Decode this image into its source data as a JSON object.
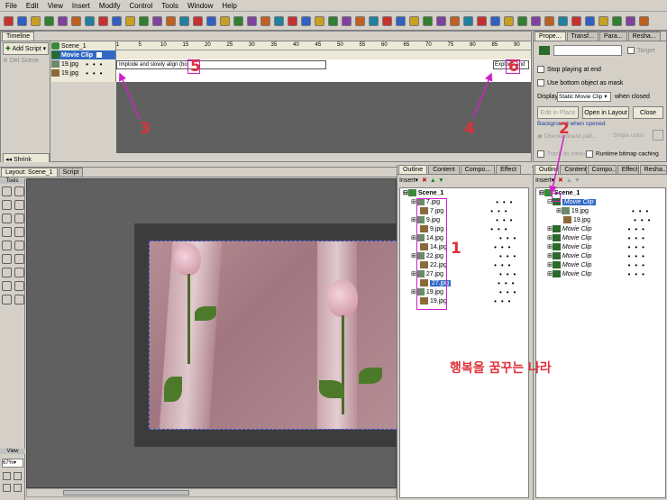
{
  "menu": {
    "file": "File",
    "edit": "Edit",
    "view": "View",
    "insert": "Insert",
    "modify": "Modify",
    "control": "Control",
    "tools": "Tools",
    "window": "Window",
    "help": "Help"
  },
  "timeline": {
    "title": "Timeline",
    "add_script": "Add Script",
    "del_scene": "Del Scene",
    "shrink": "Shrink",
    "scene_row": "Scene_1",
    "movie_clip_row": "Movie Clip",
    "layer1": "19.jpg",
    "layer2": "19.jpg",
    "effect_left": "Implode and slowly align (bo",
    "effect_right": "Explode and",
    "ruler": [
      "1",
      "5",
      "10",
      "15",
      "20",
      "25",
      "30",
      "35",
      "40",
      "45",
      "50",
      "55",
      "60",
      "65",
      "70",
      "75",
      "80",
      "85",
      "90"
    ]
  },
  "layout": {
    "tab_layout": "Layout: Scene_1",
    "tab_script": "Script",
    "tools_label": "Tools",
    "view_label": "View",
    "zoom": "67%"
  },
  "outline1": {
    "tabs": [
      "Outline",
      "Content",
      "Compo...",
      "Effect"
    ],
    "insert": "Insert",
    "scene": "Scene_1",
    "items": [
      "7.jpg",
      "7.jpg",
      "9.jpg",
      "9.jpg",
      "14.jpg",
      "14.jpg",
      "22.jpg",
      "22.jpg",
      "27.jpg",
      "27.jpg",
      "19.jpg",
      "19.jpg"
    ],
    "selected_index": 9
  },
  "outline2": {
    "tabs": [
      "Outline",
      "Content",
      "Compo...",
      "Effect",
      "Resha..."
    ],
    "insert": "Insert",
    "scene": "Scene_1",
    "movie_clip_selected": "Movie Clip",
    "child": "19.jpg",
    "child2": "19.jpg",
    "clips": [
      "Movie Clip",
      "Movie Clip",
      "Movie Clip",
      "Movie Clip",
      "Movie Clip",
      "Movie Clip"
    ]
  },
  "props": {
    "tabs": [
      "Prope...",
      "Transf...",
      "Para...",
      "Resha..."
    ],
    "target": "Target",
    "stop_playing": "Stop playing at end",
    "use_mask": "Use bottom object as mask",
    "display_label": "Display",
    "display_value": "Static Movie Clip",
    "when_closed": "when closed",
    "edit_in_place": "Edit in Place",
    "open_in_layout": "Open in Layout",
    "close": "Close",
    "bg_label": "Background when opened",
    "checkerboard": "Checkerboard patt...",
    "single_color": "Single color:",
    "track_menu": "Track as menu",
    "runtime_cache": "Runtime bitmap caching"
  },
  "annotations": {
    "a1": "1",
    "a2": "2",
    "a3": "3",
    "a4": "4",
    "a5": "5",
    "a6": "6",
    "korean": "행복을 꿈꾸는 나라"
  },
  "colors": {
    "accent": "#d020c8",
    "annotation": "#e0303a",
    "selection": "#316ac5"
  }
}
